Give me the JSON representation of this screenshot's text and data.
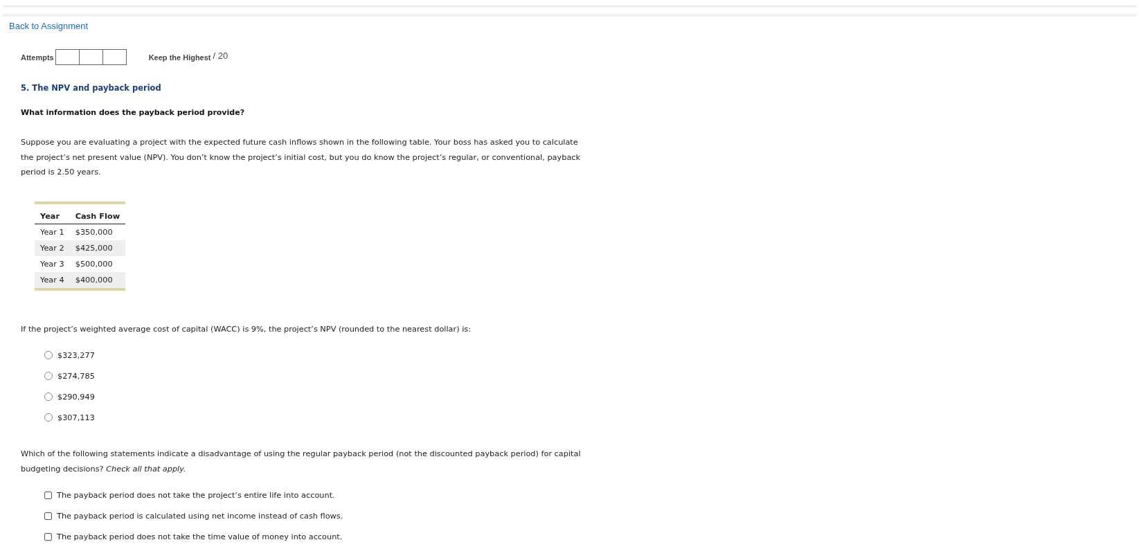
{
  "back_link": "Back to Assignment",
  "attempts": {
    "label": "Attempts",
    "policy": "Keep the Highest",
    "score": "/ 20"
  },
  "question_title": "5. The NPV and payback period",
  "subheading": "What information does the payback period provide?",
  "intro": "Suppose you are evaluating a project with the expected future cash inflows shown in the following table. Your boss has asked you to calculate the project’s net present value (NPV). You don’t know the project’s initial cost, but you do know the project’s regular, or conventional, payback period is 2.50 years.",
  "table": {
    "columns": [
      "Year",
      "Cash Flow"
    ],
    "rows": [
      [
        "Year 1",
        "$350,000"
      ],
      [
        "Year 2",
        "$425,000"
      ],
      [
        "Year 3",
        "$500,000"
      ],
      [
        "Year 4",
        "$400,000"
      ]
    ]
  },
  "npv_question": "If the project’s weighted average cost of capital (WACC) is 9%, the project’s NPV (rounded to the nearest dollar) is:",
  "npv_options": [
    {
      "label": "$323,277",
      "selected": false
    },
    {
      "label": "$274,785",
      "selected": false
    },
    {
      "label": "$290,949",
      "selected": false
    },
    {
      "label": "$307,113",
      "selected": false
    }
  ],
  "disadvantage_question": "Which of the following statements indicate a disadvantage of using the regular payback period (not the discounted payback period) for capital budgeting decisions? *Check all that apply.*",
  "disadvantage_options": [
    {
      "label": "The payback period does not take the project’s entire life into account.",
      "checked": false
    },
    {
      "label": "The payback period is calculated using net income instead of cash flows.",
      "checked": false
    },
    {
      "label": "The payback period does not take the time value of money into account.",
      "checked": false
    }
  ]
}
